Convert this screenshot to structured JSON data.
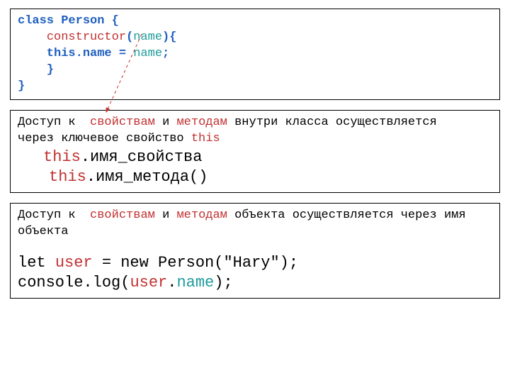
{
  "code_box": {
    "l1": {
      "a": "class ",
      "b": "Person {"
    },
    "l2": {
      "a": "    ",
      "b": "constructor",
      "c": "(",
      "d": "name",
      "e": "){"
    },
    "l3": {
      "a": "    this.name ",
      "b": "= ",
      "c": "name",
      "d": ";"
    },
    "l4": "    }",
    "l5": "}"
  },
  "note1": {
    "line1": {
      "a": "Доступ к  ",
      "b": "свойствам ",
      "c": "и ",
      "d": "методам ",
      "e": "внутри класса осуществляется"
    },
    "line2": {
      "a": "через ключевое свойство ",
      "b": "this"
    },
    "ex1": {
      "a": "this",
      "b": ".имя_свойства"
    },
    "ex2": {
      "a": "this",
      "b": ".имя_метода()"
    }
  },
  "note2": {
    "line1": {
      "a": "Доступ к  ",
      "b": "свойствам ",
      "c": "и ",
      "d": "методам ",
      "e": "объекта осуществляется через имя"
    },
    "line2": "объекта",
    "code1": {
      "a": "let ",
      "b": "user ",
      "c": "= new Person(\"Hary\");"
    },
    "code2": {
      "a": "console.log(",
      "b": "user",
      "c": ".",
      "d": "name",
      "e": ");"
    }
  }
}
